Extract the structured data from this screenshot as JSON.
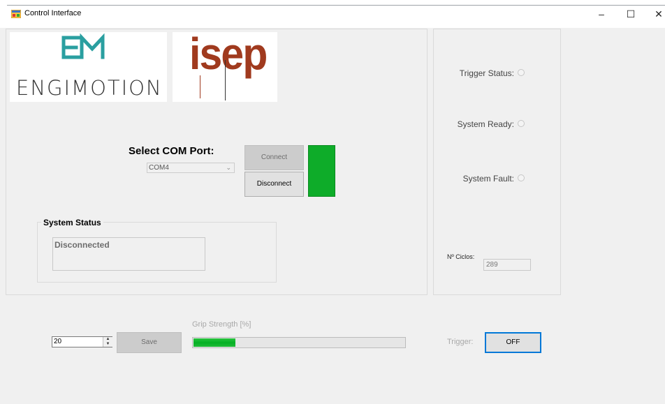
{
  "window": {
    "title": "Control Interface",
    "minimize_glyph": "–",
    "maximize_glyph": "☐",
    "close_glyph": "✕",
    "icon": "app-window-icon"
  },
  "logos": {
    "engimotion_text": "ENGIMOTION",
    "isep_text": "isep",
    "engimotion_color": "#2a9fa0",
    "isep_color": "#a03a1e"
  },
  "connection": {
    "select_label": "Select COM Port:",
    "selected_port": "COM4",
    "connect_label": "Connect",
    "disconnect_label": "Disconnect",
    "indicator_color": "#0eac29"
  },
  "system_status": {
    "legend": "System Status",
    "value": "Disconnected"
  },
  "status_panel": {
    "trigger_status_label": "Trigger Status:",
    "system_ready_label": "System Ready:",
    "system_fault_label": "System Fault:",
    "ciclos_label": "Nº Ciclos:",
    "ciclos_value": "289"
  },
  "grip": {
    "value": "20",
    "save_label": "Save",
    "strength_label": "Grip Strength [%]",
    "strength_fraction": 0.2
  },
  "trigger": {
    "label": "Trigger:",
    "button_label": "OFF",
    "accent_color": "#0078d7"
  }
}
